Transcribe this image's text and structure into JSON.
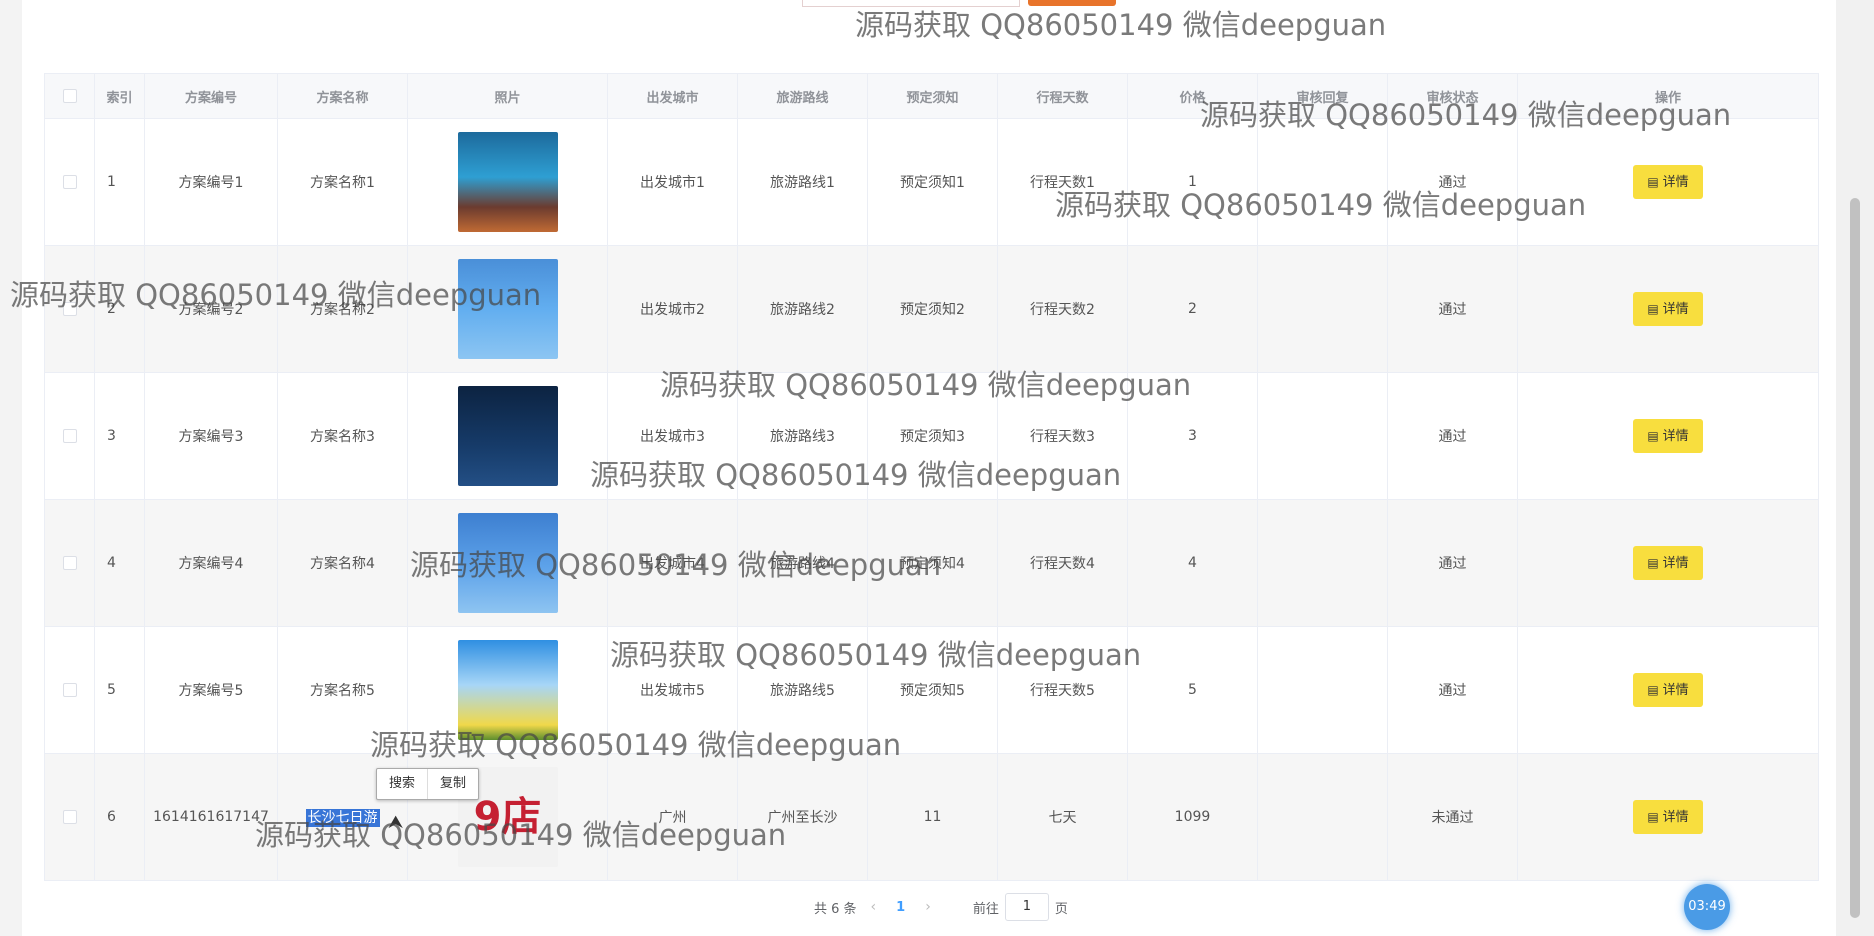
{
  "columns": [
    "索引",
    "方案编号",
    "方案名称",
    "照片",
    "出发城市",
    "旅游路线",
    "预定须知",
    "行程天数",
    "价格",
    "审核回复",
    "审核状态",
    "操作"
  ],
  "rows": [
    {
      "index": "1",
      "code": "方案编号1",
      "name": "方案名称1",
      "city": "出发城市1",
      "route": "旅游路线1",
      "notice": "预定须知1",
      "days": "行程天数1",
      "price": "1",
      "reply": "",
      "status": "通过"
    },
    {
      "index": "2",
      "code": "方案编号2",
      "name": "方案名称2",
      "city": "出发城市2",
      "route": "旅游路线2",
      "notice": "预定须知2",
      "days": "行程天数2",
      "price": "2",
      "reply": "",
      "status": "通过"
    },
    {
      "index": "3",
      "code": "方案编号3",
      "name": "方案名称3",
      "city": "出发城市3",
      "route": "旅游路线3",
      "notice": "预定须知3",
      "days": "行程天数3",
      "price": "3",
      "reply": "",
      "status": "通过"
    },
    {
      "index": "4",
      "code": "方案编号4",
      "name": "方案名称4",
      "city": "出发城市4",
      "route": "旅游路线4",
      "notice": "预定须知4",
      "days": "行程天数4",
      "price": "4",
      "reply": "",
      "status": "通过"
    },
    {
      "index": "5",
      "code": "方案编号5",
      "name": "方案名称5",
      "city": "出发城市5",
      "route": "旅游路线5",
      "notice": "预定须知5",
      "days": "行程天数5",
      "price": "5",
      "reply": "",
      "status": "通过"
    },
    {
      "index": "6",
      "code": "1614161617147",
      "name": "长沙七日游",
      "city": "广州",
      "route": "广州至长沙",
      "notice": "11",
      "days": "七天",
      "price": "1099",
      "reply": "",
      "status": "未通过"
    }
  ],
  "thumb6_text": "9店",
  "action_label": "详情",
  "context_menu": {
    "search": "搜索",
    "copy": "复制"
  },
  "pagination": {
    "total_text": "共 6 条",
    "current": "1",
    "goto_label": "前往",
    "page_value": "1",
    "page_suffix": "页"
  },
  "timer": "03:49",
  "watermark": "源码获取 QQ86050149 微信deepguan"
}
